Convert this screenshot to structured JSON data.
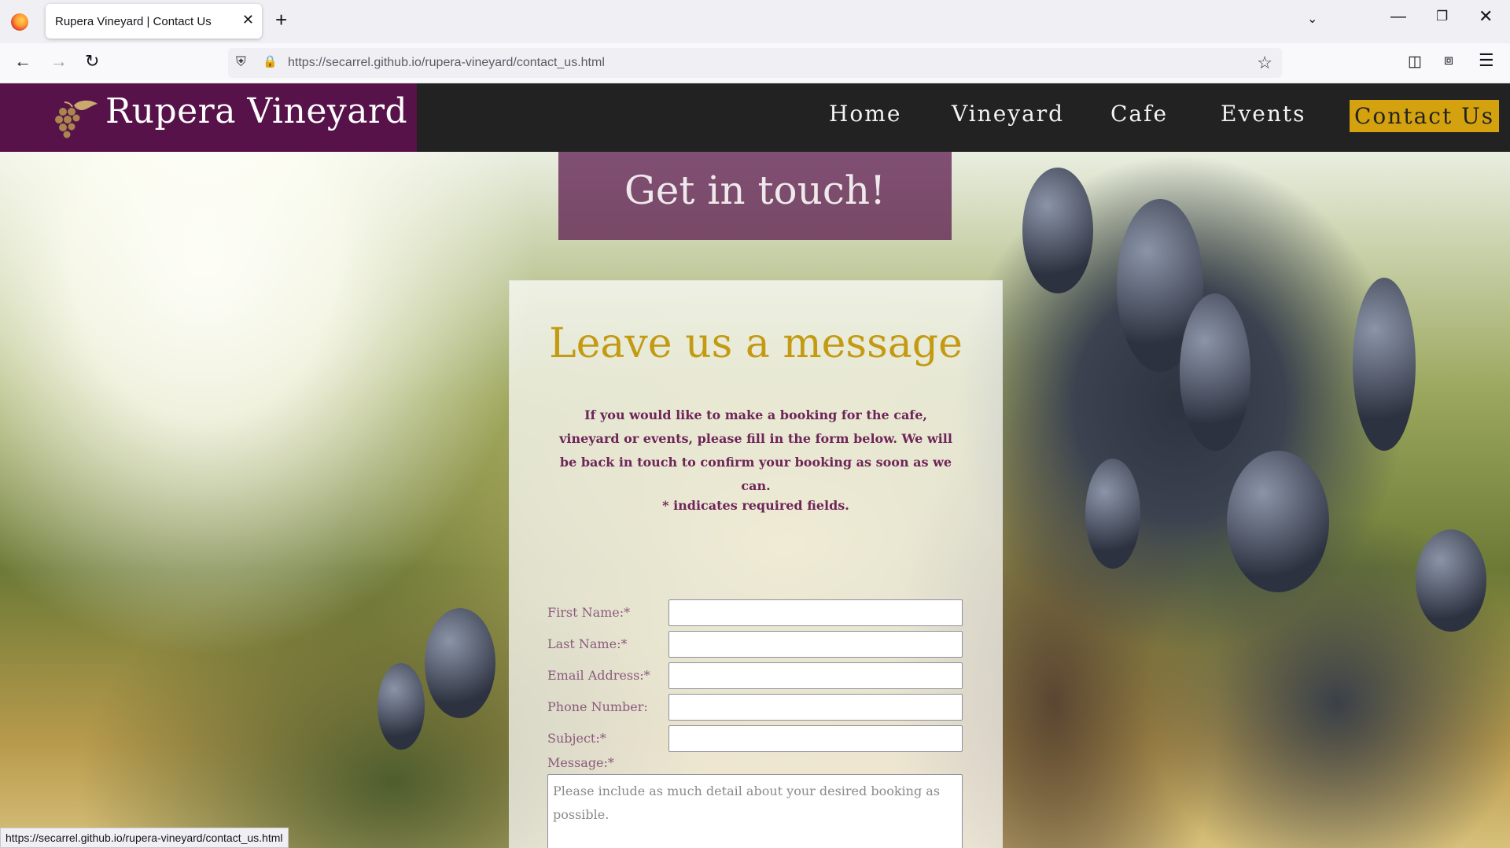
{
  "browser": {
    "tab_title": "Rupera Vineyard | Contact Us",
    "tab_close": "✕",
    "new_tab": "+",
    "url_host": "https://secarrel.github.io",
    "url_path": "/rupera-vineyard/contact_us.html",
    "status_url": "https://secarrel.github.io/rupera-vineyard/contact_us.html"
  },
  "icons": {
    "back": "arrow-left-icon",
    "forward": "arrow-right-icon",
    "reload": "reload-icon",
    "shield": "shield-icon",
    "lock": "lock-icon",
    "star": "star-icon",
    "pocket": "pocket-icon",
    "extensions": "puzzle-icon",
    "menu": "hamburger-icon",
    "logo": "grape-leaf-icon"
  },
  "colors": {
    "brand_purple": "#58124a",
    "header_dark": "#222222",
    "gold_accent": "#d4a20f",
    "heading_gold": "#c39a12",
    "text_plum": "#6e2558"
  },
  "site": {
    "brand_name": "Rupera Vineyard",
    "nav": {
      "home": "Home",
      "vineyard": "Vineyard",
      "cafe": "Cafe",
      "events": "Events",
      "contact": "Contact Us"
    },
    "active_nav": "Contact Us"
  },
  "page": {
    "title": "Get in touch!"
  },
  "form": {
    "heading": "Leave us a message",
    "intro": "If you would like to make a booking for the cafe, vineyard or events, please fill in the form below. We will be back in touch to confirm your booking as soon as we can.",
    "required_note": "* indicates required fields.",
    "fields": {
      "first_name": "First Name:*",
      "last_name": "Last Name:*",
      "email": "Email Address:*",
      "phone": "Phone Number:",
      "subject": "Subject:*",
      "message": "Message:*"
    },
    "message_placeholder": "Please include as much detail about your desired booking as possible."
  }
}
